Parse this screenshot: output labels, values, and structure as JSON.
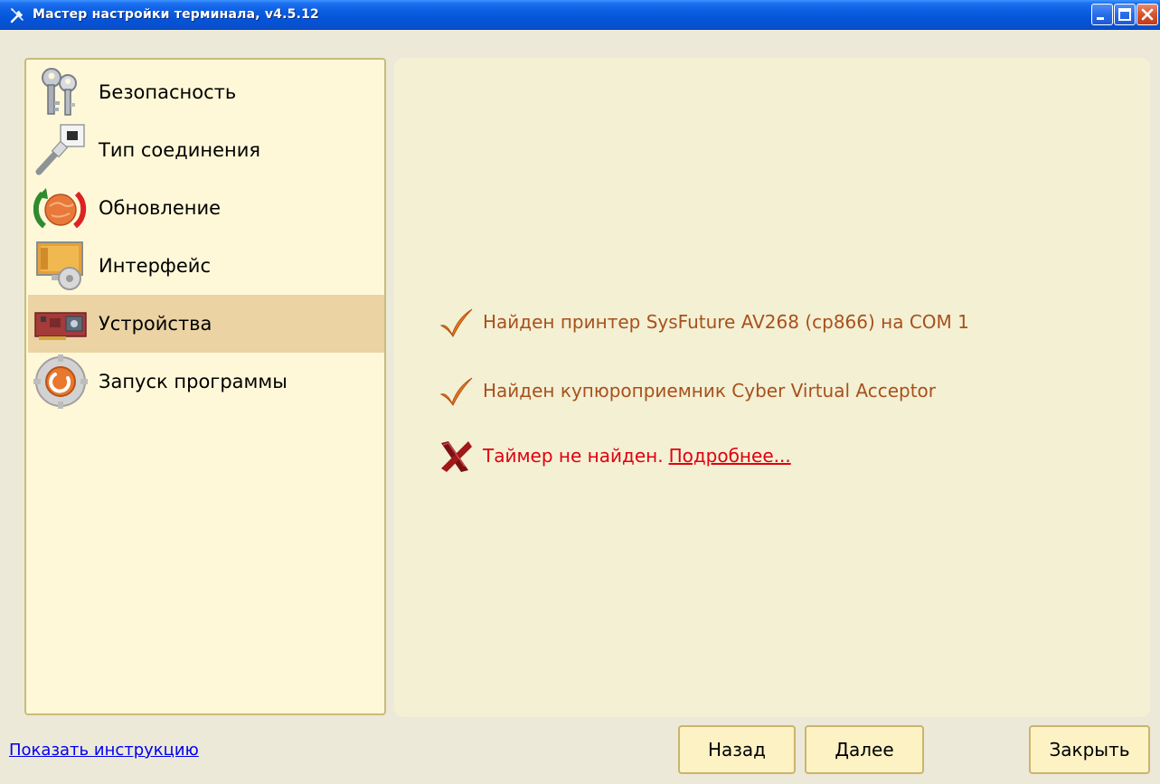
{
  "window": {
    "title": "Мастер настройки терминала, v4.5.12",
    "title_icon": "wrench-screwdriver-icon",
    "controls": [
      "minimize-icon",
      "maximize-icon",
      "close-icon"
    ]
  },
  "sidebar": {
    "items": [
      {
        "label": "Безопасность",
        "icon": "keys-icon",
        "active": false
      },
      {
        "label": "Тип соединения",
        "icon": "network-cable-icon",
        "active": false
      },
      {
        "label": "Обновление",
        "icon": "update-globe-icon",
        "active": false
      },
      {
        "label": "Интерфейс",
        "icon": "interface-gear-icon",
        "active": false
      },
      {
        "label": "Устройства",
        "icon": "device-card-icon",
        "active": true
      },
      {
        "label": "Запуск программы",
        "icon": "program-launch-icon",
        "active": false
      }
    ]
  },
  "messages": [
    {
      "status": "ok",
      "icon": "checkmark-icon",
      "text": "Найден принтер SysFuture AV268 (cp866) на COM 1"
    },
    {
      "status": "ok",
      "icon": "checkmark-icon",
      "text": "Найден купюроприемник Cyber Virtual Acceptor"
    },
    {
      "status": "error",
      "icon": "cross-icon",
      "text": "Таймер не найден.",
      "link": "Подробнее..."
    }
  ],
  "footer": {
    "help_link": "Показать инструкцию",
    "back_label": "Назад",
    "next_label": "Далее",
    "close_label": "Закрыть"
  },
  "colors": {
    "ok_text": "#a8501c",
    "error_text": "#e00010",
    "active_item": "#ebd3a4",
    "sidebar_bg": "#fff8d8",
    "panel_bg": "#f3f0d4"
  }
}
